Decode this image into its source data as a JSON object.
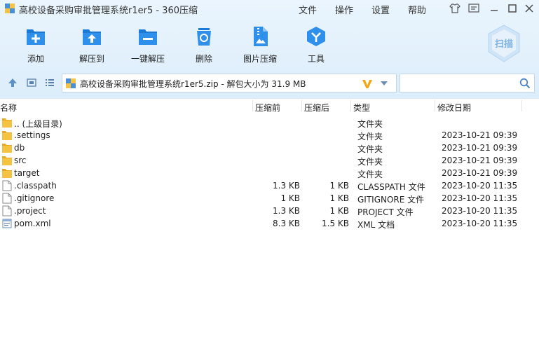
{
  "window": {
    "title": "高校设备采购审批管理系统r1er5 - 360压缩",
    "menu": [
      "文件",
      "操作",
      "设置",
      "帮助"
    ]
  },
  "toolbar": {
    "buttons": [
      {
        "label": "添加",
        "icon": "add-icon"
      },
      {
        "label": "解压到",
        "icon": "extract-to-icon"
      },
      {
        "label": "一键解压",
        "icon": "one-click-extract-icon"
      },
      {
        "label": "删除",
        "icon": "delete-icon"
      },
      {
        "label": "图片压缩",
        "icon": "image-compress-icon"
      },
      {
        "label": "工具",
        "icon": "tools-icon"
      }
    ],
    "scan_label": "扫描"
  },
  "address": {
    "path": "高校设备采购审批管理系统r1er5.zip - 解包大小为 31.9 MB"
  },
  "columns": {
    "name": "名称",
    "before": "压缩前",
    "after": "压缩后",
    "type": "类型",
    "date": "修改日期"
  },
  "files": [
    {
      "name": ".. (上级目录)",
      "before": "",
      "after": "",
      "type": "文件夹",
      "date": "",
      "kind": "folder"
    },
    {
      "name": ".settings",
      "before": "",
      "after": "",
      "type": "文件夹",
      "date": "2023-10-21 09:39",
      "kind": "folder"
    },
    {
      "name": "db",
      "before": "",
      "after": "",
      "type": "文件夹",
      "date": "2023-10-21 09:39",
      "kind": "folder"
    },
    {
      "name": "src",
      "before": "",
      "after": "",
      "type": "文件夹",
      "date": "2023-10-21 09:39",
      "kind": "folder"
    },
    {
      "name": "target",
      "before": "",
      "after": "",
      "type": "文件夹",
      "date": "2023-10-21 09:39",
      "kind": "folder"
    },
    {
      "name": ".classpath",
      "before": "1.3 KB",
      "after": "1 KB",
      "type": "CLASSPATH 文件",
      "date": "2023-10-20 11:35",
      "kind": "file"
    },
    {
      "name": ".gitignore",
      "before": "1 KB",
      "after": "1 KB",
      "type": "GITIGNORE 文件",
      "date": "2023-10-20 11:35",
      "kind": "file"
    },
    {
      "name": ".project",
      "before": "1.3 KB",
      "after": "1 KB",
      "type": "PROJECT 文件",
      "date": "2023-10-20 11:35",
      "kind": "file"
    },
    {
      "name": "pom.xml",
      "before": "8.3 KB",
      "after": "1.5 KB",
      "type": "XML 文档",
      "date": "2023-10-20 11:35",
      "kind": "xml"
    }
  ]
}
